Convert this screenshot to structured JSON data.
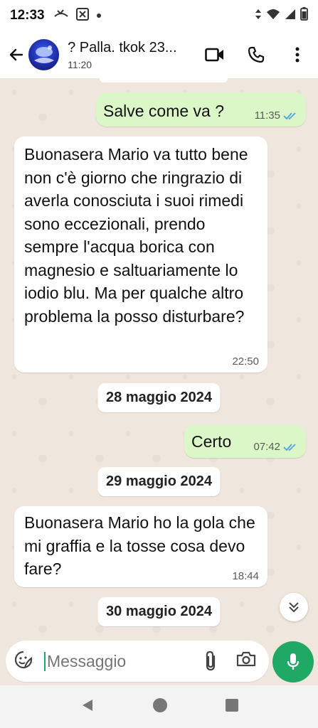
{
  "status_bar": {
    "time": "12:33"
  },
  "header": {
    "contact_name": "? Palla. tkok 23...",
    "subtitle": "11:20"
  },
  "messages": [
    {
      "direction": "out",
      "text": "Salve come va ?",
      "time": "11:35"
    },
    {
      "direction": "in",
      "text": "Buonasera Mario va tutto bene non c'è giorno che ringrazio di averla conosciuta i suoi rimedi sono eccezionali, prendo sempre l'acqua borica con magnesio e saltuariamente lo iodio blu. Ma per qualche altro problema la posso disturbare?",
      "time": "22:50"
    },
    {
      "direction": "out",
      "text": "Certo",
      "time": "07:42"
    },
    {
      "direction": "in",
      "text": "Buonasera Mario ho la gola che mi graffia e la  tosse cosa devo fare?",
      "time": "18:44"
    }
  ],
  "dates": [
    "28 maggio 2024",
    "29 maggio 2024",
    "30 maggio 2024"
  ],
  "composer": {
    "placeholder": "Messaggio"
  },
  "colors": {
    "accent": "#20a865",
    "outgoing": "#dcf7c7",
    "read_ticks": "#4fa3e0",
    "chat_bg": "#efe7de"
  },
  "icons": {
    "status_left": [
      "missed-call-icon",
      "box-x-icon",
      "dot-icon"
    ],
    "status_right": [
      "data-arrows-icon",
      "wifi-icon",
      "signal-icon",
      "battery-icon"
    ],
    "header": [
      "back-arrow-icon",
      "video-call-icon",
      "phone-icon",
      "more-vert-icon"
    ],
    "composer": [
      "sticker-icon",
      "attach-icon",
      "camera-icon",
      "mic-icon"
    ],
    "nav": [
      "nav-back-icon",
      "nav-home-icon",
      "nav-recents-icon"
    ]
  }
}
